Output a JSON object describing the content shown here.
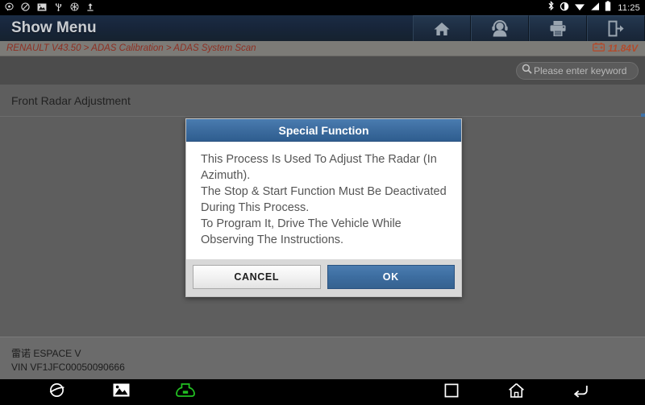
{
  "statusbar": {
    "icons_left": [
      "chat-icon",
      "no-entry-icon",
      "image-icon",
      "usb-icon",
      "snowflake-icon",
      "upload-icon"
    ],
    "icons_right": [
      "bluetooth-icon",
      "brightness-icon",
      "wifi-icon",
      "signal-icon",
      "battery-icon"
    ],
    "time": "11:25"
  },
  "header": {
    "title": "Show Menu",
    "buttons": [
      {
        "name": "home-button",
        "icon": "home-icon"
      },
      {
        "name": "support-button",
        "icon": "headset-person-icon"
      },
      {
        "name": "print-button",
        "icon": "printer-icon"
      },
      {
        "name": "exit-button",
        "icon": "exit-door-icon"
      }
    ]
  },
  "breadcrumb": {
    "path": "RENAULT V43.50 > ADAS Calibration > ADAS System Scan",
    "voltage": "11.84V",
    "voltage_icon": "battery-voltage-icon"
  },
  "search": {
    "placeholder": "Please enter keyword",
    "value": "",
    "icon": "search-icon"
  },
  "main": {
    "items": [
      {
        "label": "Front Radar Adjustment"
      }
    ]
  },
  "dialog": {
    "title": "Special Function",
    "message_lines": [
      "This Process Is Used To Adjust The Radar (In Azimuth).",
      "The Stop & Start Function Must Be Deactivated During This Process.",
      "To Program It, Drive The Vehicle While Observing The Instructions."
    ],
    "cancel_label": "CANCEL",
    "ok_label": "OK"
  },
  "footer": {
    "vehicle": "雷诺 ESPACE V",
    "vin": "VIN VF1JFC00050090666"
  },
  "navbar": {
    "items": [
      {
        "name": "browser-icon"
      },
      {
        "name": "gallery-icon"
      },
      {
        "name": "vci-connector-icon"
      },
      {
        "name": "recents-square-icon"
      },
      {
        "name": "home-icon"
      },
      {
        "name": "back-arrow-icon"
      }
    ]
  },
  "colors": {
    "accent_blue": "#3d6da0",
    "breadcrumb_red": "#8e2f22",
    "voltage_orange": "#b24b2c",
    "vci_green": "#22c022"
  }
}
